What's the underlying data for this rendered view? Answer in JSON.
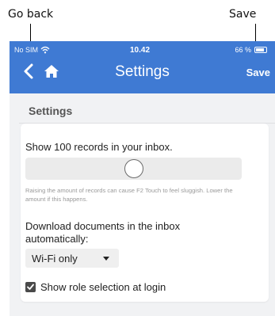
{
  "annotations": {
    "back_label": "Go back",
    "save_label": "Save"
  },
  "status_bar": {
    "carrier": "No SIM",
    "time": "10.42",
    "battery": "66 %"
  },
  "app_bar": {
    "title": "Settings",
    "save_label": "Save",
    "back_icon": "chevron-left-icon",
    "home_icon": "home-icon",
    "color": "#3f7ad3"
  },
  "settings": {
    "section_title": "Settings",
    "records_label": "Show 100 records in your inbox.",
    "records_slider_fraction": 0.5,
    "hint": "Raising the amount of records can cause F2 Touch to feel sluggish. Lower the amount if this happens.",
    "download_label": "Download documents in the inbox automatically:",
    "download_selected": "Wi-Fi only",
    "role_selection_label": "Show role selection at login",
    "role_selection_checked": true
  }
}
